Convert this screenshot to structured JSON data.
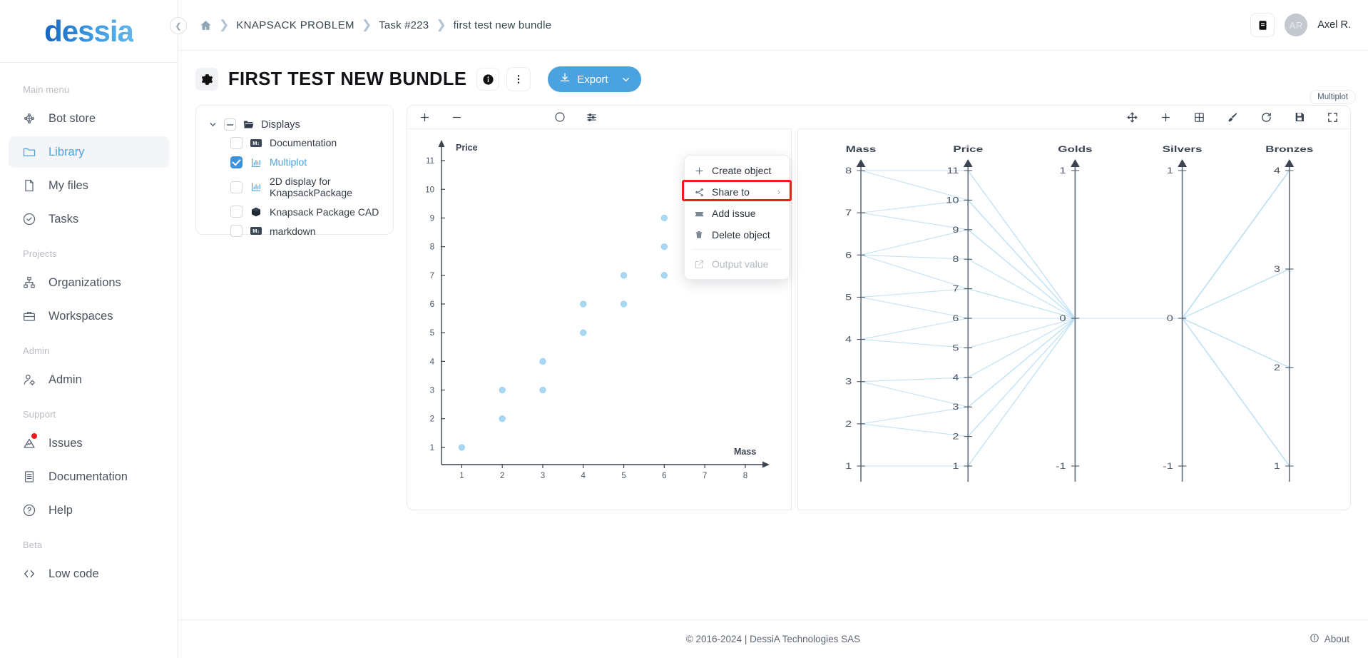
{
  "brand": {
    "name": "dessia"
  },
  "sidebar": {
    "sections": [
      {
        "label": "Main menu",
        "items": [
          {
            "label": "Bot store",
            "icon": "bot-store-icon",
            "active": false
          },
          {
            "label": "Library",
            "icon": "folder-icon",
            "active": true
          },
          {
            "label": "My files",
            "icon": "file-icon",
            "active": false
          },
          {
            "label": "Tasks",
            "icon": "check-circle-icon",
            "active": false
          }
        ]
      },
      {
        "label": "Projects",
        "items": [
          {
            "label": "Organizations",
            "icon": "org-tree-icon",
            "active": false
          },
          {
            "label": "Workspaces",
            "icon": "briefcase-icon",
            "active": false
          }
        ]
      },
      {
        "label": "Admin",
        "items": [
          {
            "label": "Admin",
            "icon": "user-gear-icon",
            "active": false
          }
        ]
      },
      {
        "label": "Support",
        "items": [
          {
            "label": "Issues",
            "icon": "alert-triangle-icon",
            "active": false,
            "dot": true
          },
          {
            "label": "Documentation",
            "icon": "book-icon",
            "active": false
          },
          {
            "label": "Help",
            "icon": "question-circle-icon",
            "active": false
          }
        ]
      },
      {
        "label": "Beta",
        "items": [
          {
            "label": "Low code",
            "icon": "code-icon",
            "active": false
          }
        ]
      }
    ]
  },
  "topbar": {
    "breadcrumb": [
      "KNAPSACK PROBLEM",
      "Task #223",
      "first test new bundle"
    ],
    "user": {
      "initials": "AR",
      "name": "Axel R."
    }
  },
  "page": {
    "title": "FIRST TEST NEW BUNDLE",
    "export_label": "Export"
  },
  "menu": {
    "items": [
      {
        "label": "Create object",
        "icon": "plus-icon",
        "disabled": false,
        "submenu": false,
        "highlighted": false
      },
      {
        "label": "Share to",
        "icon": "share-icon",
        "disabled": false,
        "submenu": true,
        "highlighted": true
      },
      {
        "label": "Add issue",
        "icon": "ticket-icon",
        "disabled": false,
        "submenu": false,
        "highlighted": false
      },
      {
        "label": "Delete object",
        "icon": "trash-icon",
        "disabled": false,
        "submenu": false,
        "highlighted": false
      },
      {
        "label": "Output value",
        "icon": "external-link-icon",
        "disabled": true,
        "submenu": false,
        "highlighted": false
      }
    ],
    "submenu_arrow": "›"
  },
  "tree": {
    "root": {
      "label": "Displays"
    },
    "children": [
      {
        "label": "Documentation",
        "icon": "markdown-icon",
        "checked": false,
        "selected": false
      },
      {
        "label": "Multiplot",
        "icon": "chart-icon",
        "checked": true,
        "selected": true
      },
      {
        "label": "2D display for KnapsackPackage",
        "icon": "chart-icon",
        "checked": false,
        "selected": false
      },
      {
        "label": "Knapsack Package CAD",
        "icon": "cube-icon",
        "checked": false,
        "selected": false
      },
      {
        "label": "markdown",
        "icon": "markdown-icon",
        "checked": false,
        "selected": false
      }
    ]
  },
  "viz_toolbar": {
    "left": [
      "plus-icon",
      "minus-icon",
      "circle-icon",
      "sliders-icon"
    ],
    "right": [
      "move-icon",
      "plus-icon",
      "grid-icon",
      "brush-icon",
      "refresh-icon",
      "save-icon",
      "fullscreen-icon"
    ],
    "tooltip": "Multiplot"
  },
  "footer": {
    "copyright": "© 2016-2024 | DessiA Technologies SAS",
    "about": "About"
  },
  "colors": {
    "accent": "#4aa3df",
    "point": "#a8d8f3",
    "line": "#bfe2f6",
    "highlight": "#f21c1c",
    "axis": "#6b7785"
  },
  "chart_data": [
    {
      "type": "scatter",
      "title": "",
      "xlabel": "Mass",
      "ylabel": "Price",
      "xlim": [
        0.5,
        8.6
      ],
      "ylim": [
        0.4,
        11.6
      ],
      "xticks": [
        1,
        2,
        3,
        4,
        5,
        6,
        7,
        8
      ],
      "yticks": [
        1,
        2,
        3,
        4,
        5,
        6,
        7,
        8,
        9,
        10,
        11
      ],
      "grid": false,
      "points": [
        {
          "x": 1,
          "y": 1
        },
        {
          "x": 2,
          "y": 2
        },
        {
          "x": 2,
          "y": 3
        },
        {
          "x": 3,
          "y": 3
        },
        {
          "x": 3,
          "y": 4
        },
        {
          "x": 4,
          "y": 5
        },
        {
          "x": 4,
          "y": 6
        },
        {
          "x": 5,
          "y": 6
        },
        {
          "x": 5,
          "y": 7
        },
        {
          "x": 6,
          "y": 7
        },
        {
          "x": 6,
          "y": 8
        },
        {
          "x": 6,
          "y": 9
        },
        {
          "x": 7,
          "y": 9
        },
        {
          "x": 7,
          "y": 10
        },
        {
          "x": 8,
          "y": 10
        },
        {
          "x": 8,
          "y": 11
        }
      ]
    },
    {
      "type": "parallel-coordinates",
      "title": "",
      "axes": [
        {
          "name": "Mass",
          "ticks": [
            1,
            2,
            3,
            4,
            5,
            6,
            7,
            8
          ],
          "min": 1,
          "max": 8
        },
        {
          "name": "Price",
          "ticks": [
            1,
            2,
            3,
            4,
            5,
            6,
            7,
            8,
            9,
            10,
            11
          ],
          "min": 1,
          "max": 11
        },
        {
          "name": "Golds",
          "ticks": [
            -1,
            0,
            1
          ],
          "min": -1,
          "max": 1
        },
        {
          "name": "Silvers",
          "ticks": [
            -1,
            0,
            1
          ],
          "min": -1,
          "max": 1
        },
        {
          "name": "Bronzes",
          "ticks": [
            1,
            2,
            3,
            4
          ],
          "min": 1,
          "max": 4
        }
      ],
      "lines": [
        {
          "Mass": 1,
          "Price": 1,
          "Golds": 0,
          "Silvers": 0,
          "Bronzes": 1
        },
        {
          "Mass": 2,
          "Price": 2,
          "Golds": 0,
          "Silvers": 0,
          "Bronzes": 1
        },
        {
          "Mass": 2,
          "Price": 3,
          "Golds": 0,
          "Silvers": 0,
          "Bronzes": 1
        },
        {
          "Mass": 3,
          "Price": 3,
          "Golds": 0,
          "Silvers": 0,
          "Bronzes": 2
        },
        {
          "Mass": 3,
          "Price": 4,
          "Golds": 0,
          "Silvers": 0,
          "Bronzes": 2
        },
        {
          "Mass": 4,
          "Price": 5,
          "Golds": 0,
          "Silvers": 0,
          "Bronzes": 2
        },
        {
          "Mass": 4,
          "Price": 6,
          "Golds": 0,
          "Silvers": 0,
          "Bronzes": 3
        },
        {
          "Mass": 5,
          "Price": 6,
          "Golds": 0,
          "Silvers": 0,
          "Bronzes": 3
        },
        {
          "Mass": 5,
          "Price": 7,
          "Golds": 0,
          "Silvers": 0,
          "Bronzes": 3
        },
        {
          "Mass": 6,
          "Price": 7,
          "Golds": 0,
          "Silvers": 0,
          "Bronzes": 4
        },
        {
          "Mass": 6,
          "Price": 8,
          "Golds": 0,
          "Silvers": 0,
          "Bronzes": 4
        },
        {
          "Mass": 6,
          "Price": 9,
          "Golds": 0,
          "Silvers": 0,
          "Bronzes": 4
        },
        {
          "Mass": 7,
          "Price": 9,
          "Golds": 0,
          "Silvers": 0,
          "Bronzes": 4
        },
        {
          "Mass": 7,
          "Price": 10,
          "Golds": 0,
          "Silvers": 0,
          "Bronzes": 4
        },
        {
          "Mass": 8,
          "Price": 10,
          "Golds": 0,
          "Silvers": 0,
          "Bronzes": 4
        },
        {
          "Mass": 8,
          "Price": 11,
          "Golds": 0,
          "Silvers": 0,
          "Bronzes": 4
        }
      ]
    }
  ]
}
